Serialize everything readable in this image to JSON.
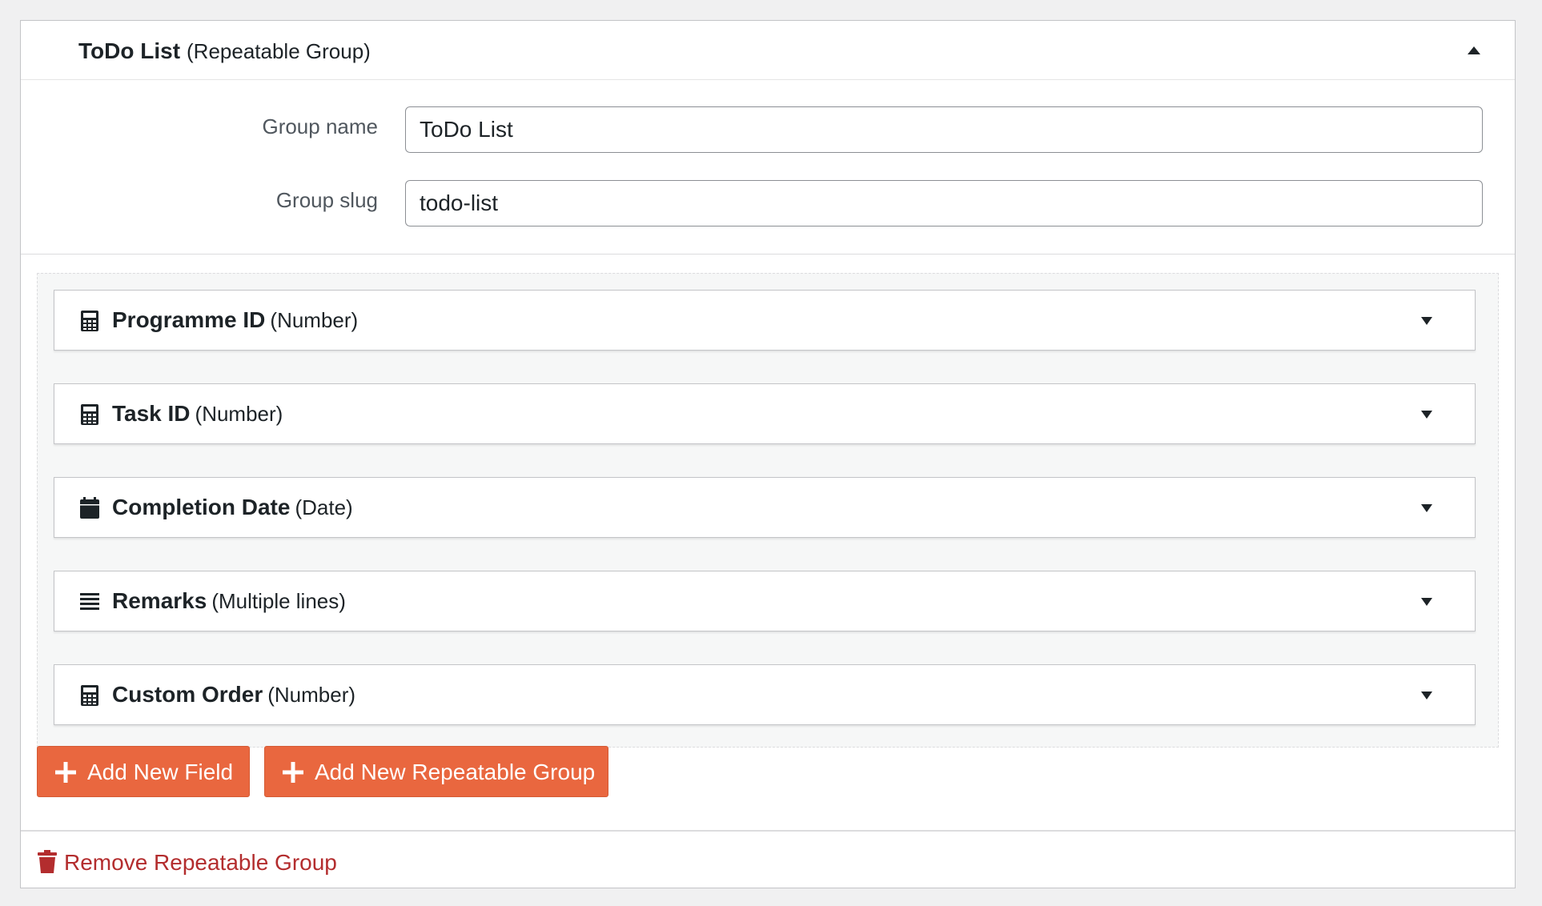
{
  "group": {
    "name": "ToDo List",
    "type": "(Repeatable Group)",
    "name_label": "Group name",
    "name_value": "ToDo List",
    "slug_label": "Group slug",
    "slug_value": "todo-list"
  },
  "fields": [
    {
      "name": "Programme ID",
      "type": "(Number)",
      "icon": "calculator-icon"
    },
    {
      "name": "Task ID",
      "type": "(Number)",
      "icon": "calculator-icon"
    },
    {
      "name": "Completion Date",
      "type": "(Date)",
      "icon": "calendar-icon"
    },
    {
      "name": "Remarks",
      "type": "(Multiple lines)",
      "icon": "lines-icon"
    },
    {
      "name": "Custom Order",
      "type": "(Number)",
      "icon": "calculator-icon"
    }
  ],
  "actions": {
    "add_field": "Add New Field",
    "add_group": "Add New Repeatable Group",
    "remove_group": "Remove Repeatable Group"
  },
  "colors": {
    "accent": "#e9673f",
    "danger": "#b32d2e"
  }
}
